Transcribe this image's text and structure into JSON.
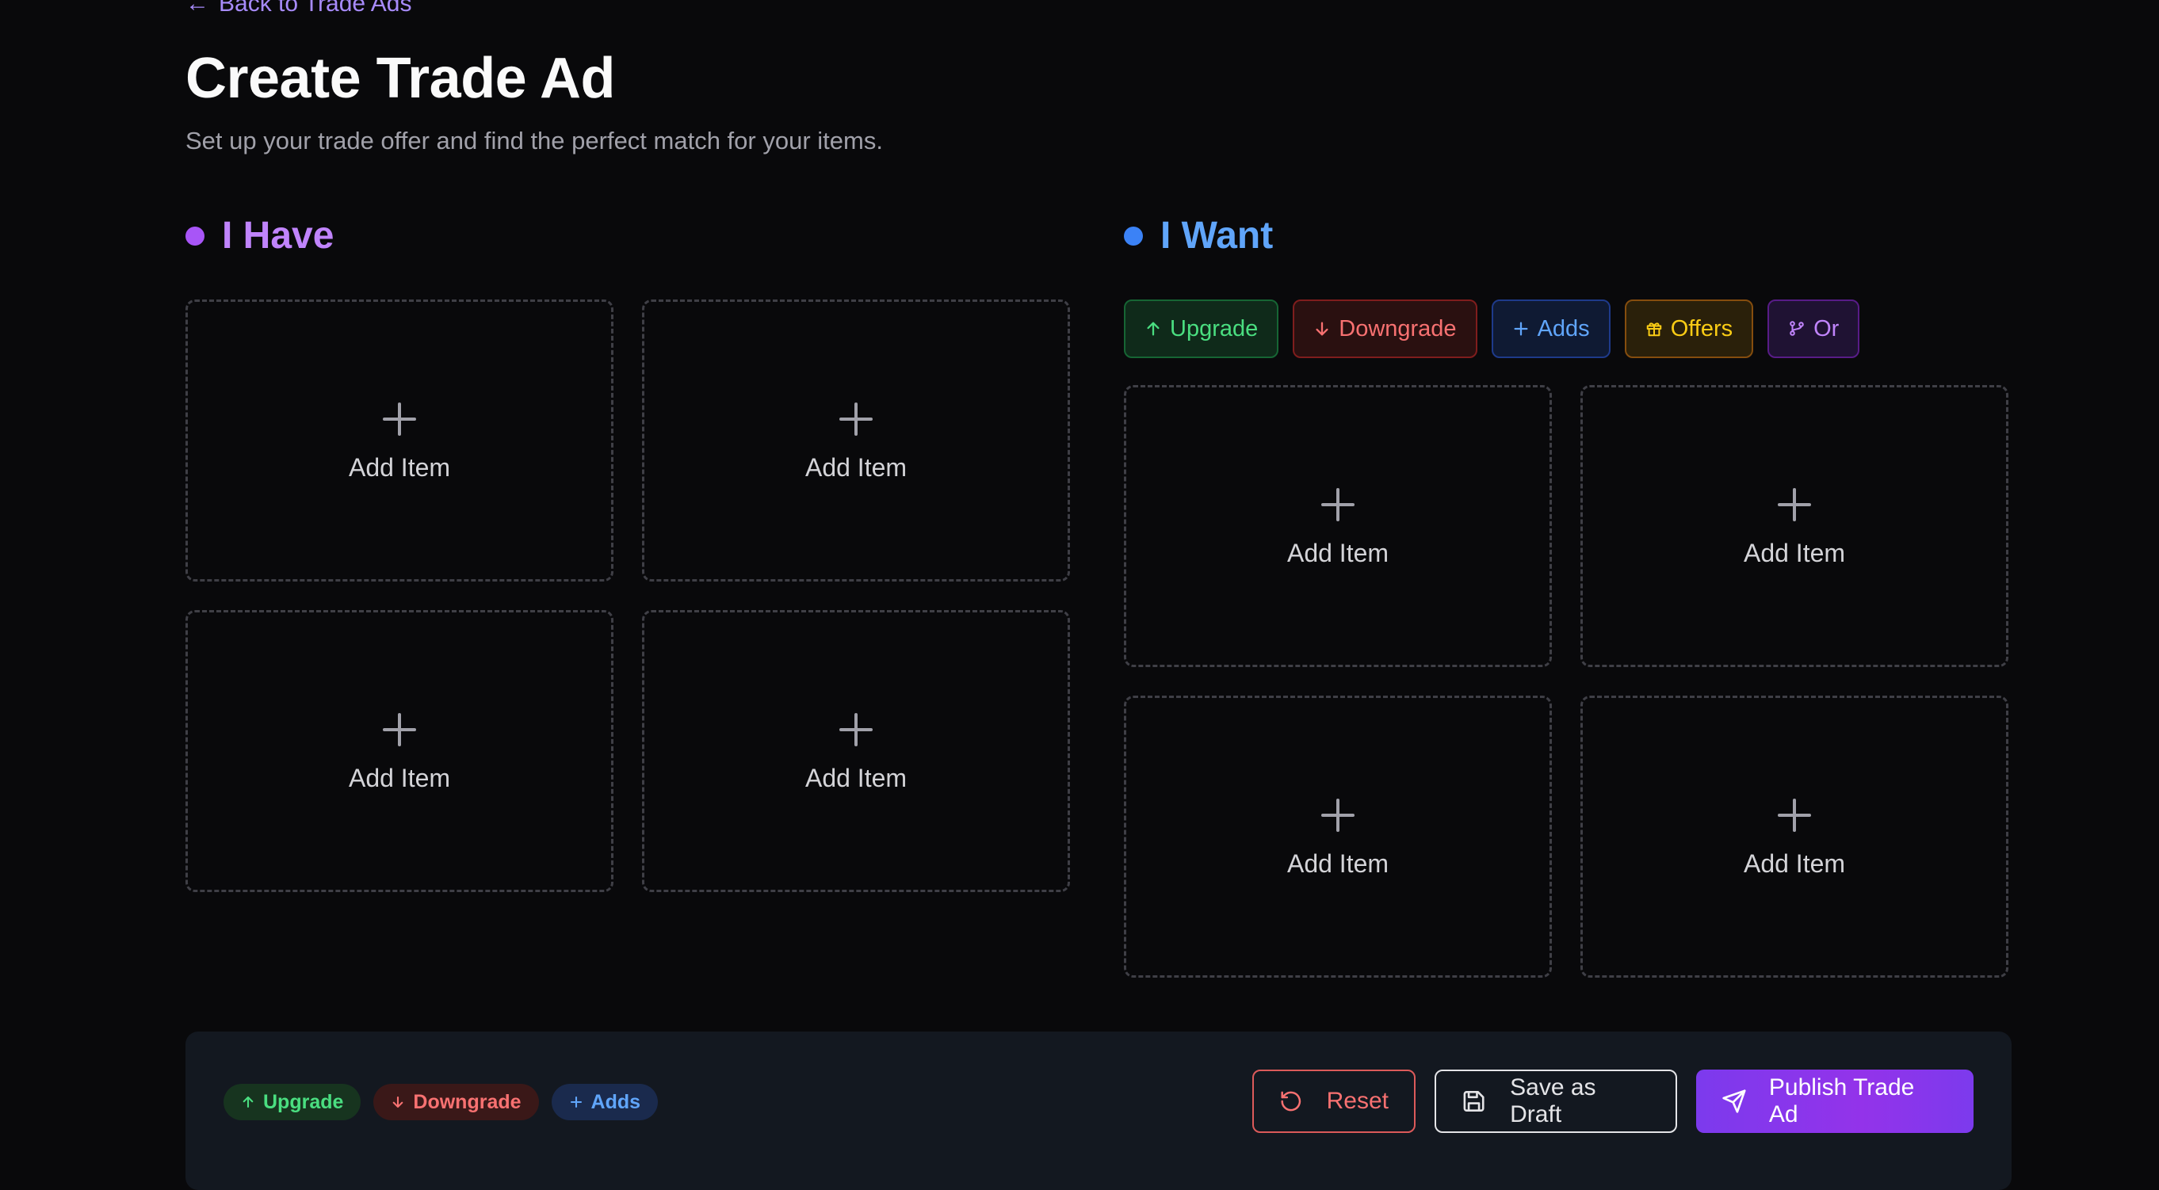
{
  "nav": {
    "back_label": "Back to Trade Ads"
  },
  "header": {
    "title": "Create Trade Ad",
    "subtitle": "Set up your trade offer and find the perfect match for your items."
  },
  "have": {
    "heading": "I Have",
    "slots": [
      "Add Item",
      "Add Item",
      "Add Item",
      "Add Item"
    ]
  },
  "want": {
    "heading": "I Want",
    "tags": [
      {
        "label": "Upgrade",
        "icon": "arrow-up-icon"
      },
      {
        "label": "Downgrade",
        "icon": "arrow-down-icon"
      },
      {
        "label": "Adds",
        "icon": "plus-icon"
      },
      {
        "label": "Offers",
        "icon": "gift-icon"
      },
      {
        "label": "Or",
        "icon": "branch-icon"
      }
    ],
    "slots": [
      "Add Item",
      "Add Item",
      "Add Item",
      "Add Item"
    ]
  },
  "footer": {
    "selected_tags": [
      {
        "label": "Upgrade",
        "icon": "arrow-up-icon"
      },
      {
        "label": "Downgrade",
        "icon": "arrow-down-icon"
      },
      {
        "label": "Adds",
        "icon": "plus-icon"
      }
    ],
    "reset_label": "Reset",
    "draft_label": "Save as Draft",
    "publish_label": "Publish Trade Ad"
  },
  "colors": {
    "background": "#09090b",
    "have_accent": "#a855f7",
    "want_accent": "#3b82f6",
    "upgrade": "#4ade80",
    "downgrade": "#f87171",
    "adds": "#60a5fa",
    "offers": "#facc15",
    "or": "#c084fc"
  }
}
